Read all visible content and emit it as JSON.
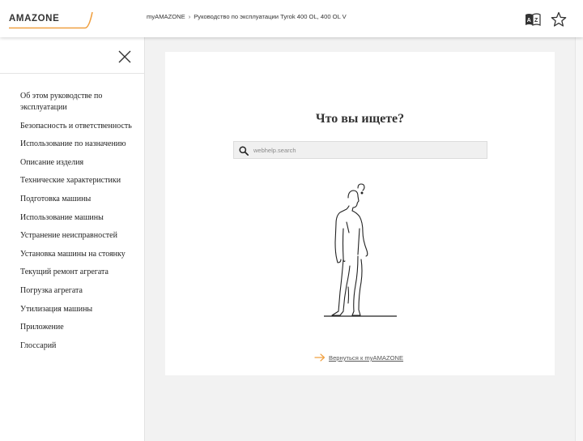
{
  "header": {
    "logo_text": "AMAZONE",
    "breadcrumb": [
      "myAMAZONE",
      "Руководство по эксплуатации Tyrok 400 OL, 400 OL V"
    ],
    "breadcrumb_separator": "›",
    "icons": [
      "language-icon",
      "star-icon"
    ]
  },
  "sidebar": {
    "close_icon": "close-icon",
    "items": [
      {
        "label": "Об этом руководстве по эксплуатации"
      },
      {
        "label": "Безопасность и ответственность"
      },
      {
        "label": "Использование по назначению"
      },
      {
        "label": "Описание изделия"
      },
      {
        "label": "Технические характеристики"
      },
      {
        "label": "Подготовка машины"
      },
      {
        "label": "Использование машины"
      },
      {
        "label": "Устранение неисправностей"
      },
      {
        "label": "Установка машины на стоянку"
      },
      {
        "label": "Текущий ремонт агрегата"
      },
      {
        "label": "Погрузка агрегата"
      },
      {
        "label": "Утилизация машины"
      },
      {
        "label": "Приложение"
      },
      {
        "label": "Глоссарий"
      }
    ]
  },
  "main": {
    "title": "Что вы ищете?",
    "search": {
      "placeholder": "webhelp.search",
      "value": ""
    },
    "back_link": "Вернуться к myAMAZONE"
  },
  "colors": {
    "accent": "#f0a040",
    "background": "#f2f2f2",
    "card": "#ffffff"
  }
}
